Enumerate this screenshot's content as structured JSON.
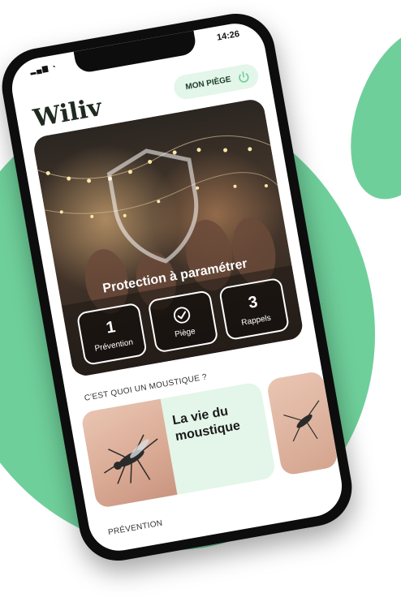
{
  "status_bar": {
    "time": "14:26"
  },
  "header": {
    "brand": "Wiliv",
    "trap_button": "MON PIÈGE"
  },
  "hero": {
    "title": "Protection à paramétrer",
    "stats": [
      {
        "value": "1",
        "label": "Prévention"
      },
      {
        "value": "",
        "label": "Piège",
        "icon": "check-icon"
      },
      {
        "value": "3",
        "label": "Rappels"
      }
    ]
  },
  "mosquito_section": {
    "label": "C'EST QUOI UN MOUSTIQUE ?",
    "card_title": "La vie du moustique"
  },
  "prevention_section": {
    "label": "PRÉVENTION"
  },
  "colors": {
    "brand_green": "#6fcf9a",
    "card_tint": "#e3f6e9"
  }
}
